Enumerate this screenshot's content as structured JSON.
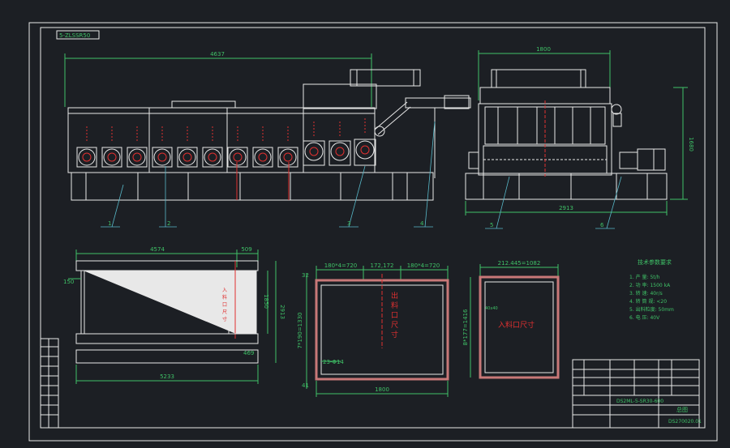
{
  "sheet": {
    "tag": "5-ZLSSR50"
  },
  "front_view": {
    "overall_length": "4637",
    "callouts": [
      "1",
      "2",
      "3",
      "4"
    ]
  },
  "side_view": {
    "width_top": "1800",
    "height": "1680",
    "width_bottom": "2913",
    "callouts": [
      "5",
      "6"
    ]
  },
  "hopper_view": {
    "top_left_dim": "4574",
    "top_right_dim": "509",
    "left_small": "150",
    "right_dim_a": "1850",
    "right_dim_b": "2913",
    "right_dim_c": "469",
    "bottom_dim": "5233",
    "vertical_text": "入料口尺寸"
  },
  "outlet_view": {
    "top_left": "180*4=720",
    "top_mid": "172,172",
    "top_right": "180*4=720",
    "left_top": "32",
    "left_side": "7*190=1330",
    "bolt_label": "23-Φ14",
    "left_bottom": "41",
    "bottom": "1800",
    "center_text": "出料口尺寸"
  },
  "inlet_view": {
    "top": "212.445=1082",
    "left": "8*177=1416",
    "left_small": "40x40",
    "center_text": "入料口尺寸"
  },
  "tech_notes": {
    "title": "技术参数要求",
    "items": [
      "1. 产 量: 5t/h",
      "2. 功 率: 1500 kA",
      "3. 转 速: 40r/s",
      "4. 转 筒 规: <20",
      "5. 出料粒度: 50mm",
      "6. 电 压: 40V"
    ]
  },
  "title_block": {
    "drawing_no": "DS2ML-5-SR30-600",
    "name": "总图",
    "code": "DS270020.01"
  },
  "colors": {
    "background": "#1c1f24",
    "lines": "#e8e8e8",
    "dimensions": "#3fc267",
    "centerlines": "#e03030",
    "leaders": "#58b8c8"
  }
}
